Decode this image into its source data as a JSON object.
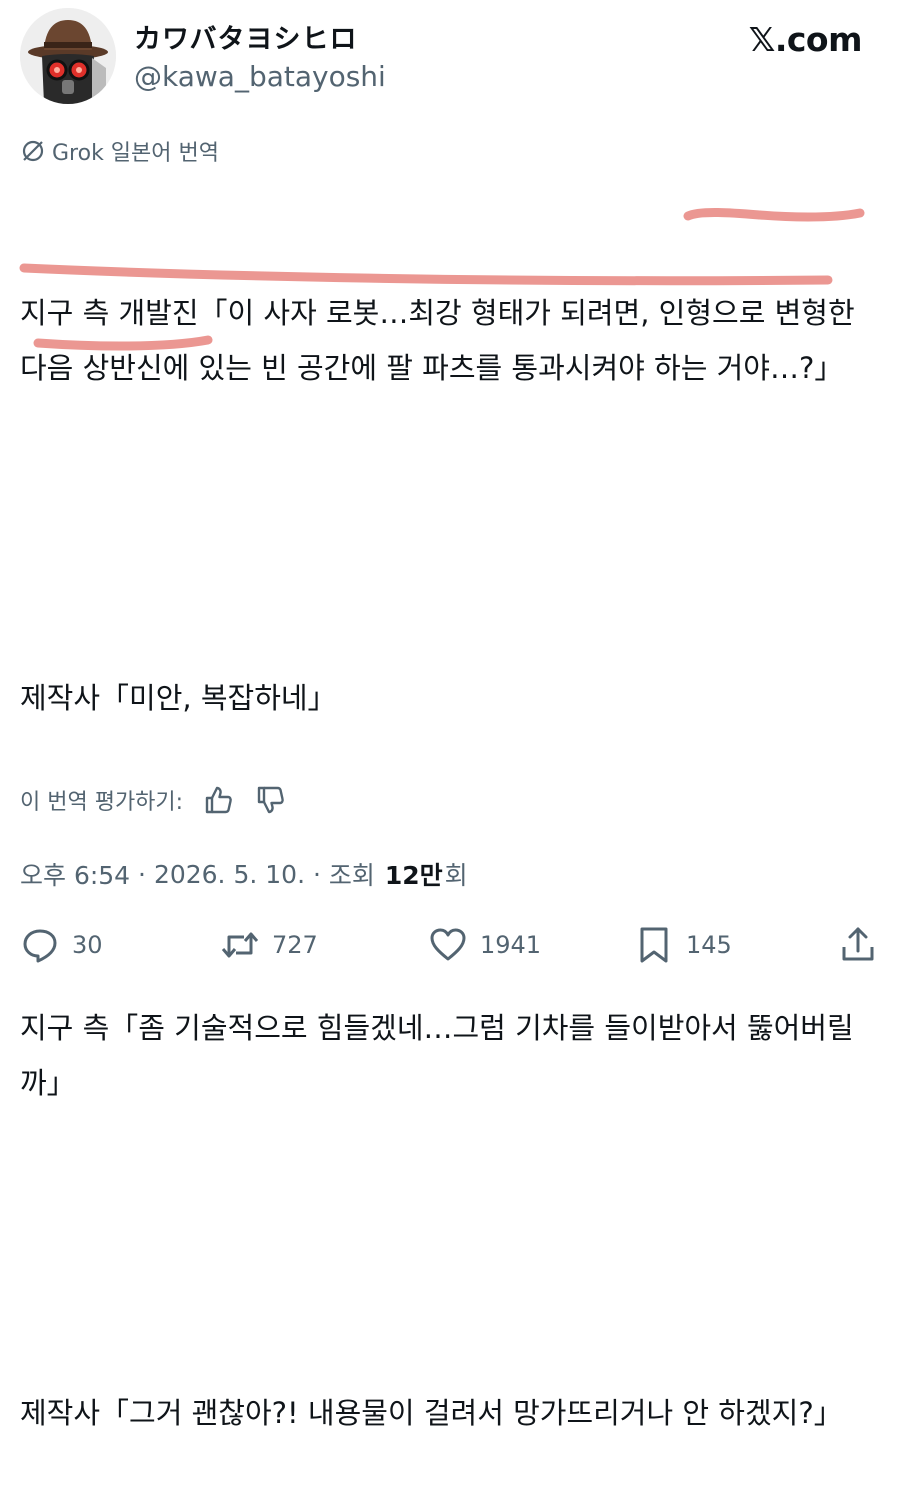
{
  "author": {
    "display_name": "カワバタヨシヒロ",
    "handle": "@kawa_batayoshi"
  },
  "source": "𝕏.com",
  "translation_label": "Grok 일본어 번역",
  "tweet": {
    "paragraphs": [
      "지구 측 개발진「이 사자 로봇…최강 형태가 되려면, 인형으로 변형한 다음 상반신에 있는 빈 공간에 팔 파츠를 통과시켜야 하는 거야…?」",
      "제작사「미안, 복잡하네」",
      "지구 측「좀 기술적으로 힘들겠네…그럼 기차를 들이받아서 뚫어버릴까」",
      "제작사「그거 괜찮아?! 내용물이 걸려서 망가뜨리거나 안 하겠지?」"
    ]
  },
  "rate_translation_label": "이 번역 평가하기:",
  "meta": {
    "time": "오후 6:54",
    "separator1": " · ",
    "date": "2026. 5. 10.",
    "separator2": " · ",
    "views_label": "조회",
    "views_count": "12만",
    "views_unit": "회"
  },
  "actions": {
    "replies": "30",
    "reposts": "727",
    "likes": "1941",
    "bookmarks": "145"
  },
  "colors": {
    "highlight": "#e8857f",
    "secondary_text": "#536471",
    "primary_text": "#0f1419"
  }
}
